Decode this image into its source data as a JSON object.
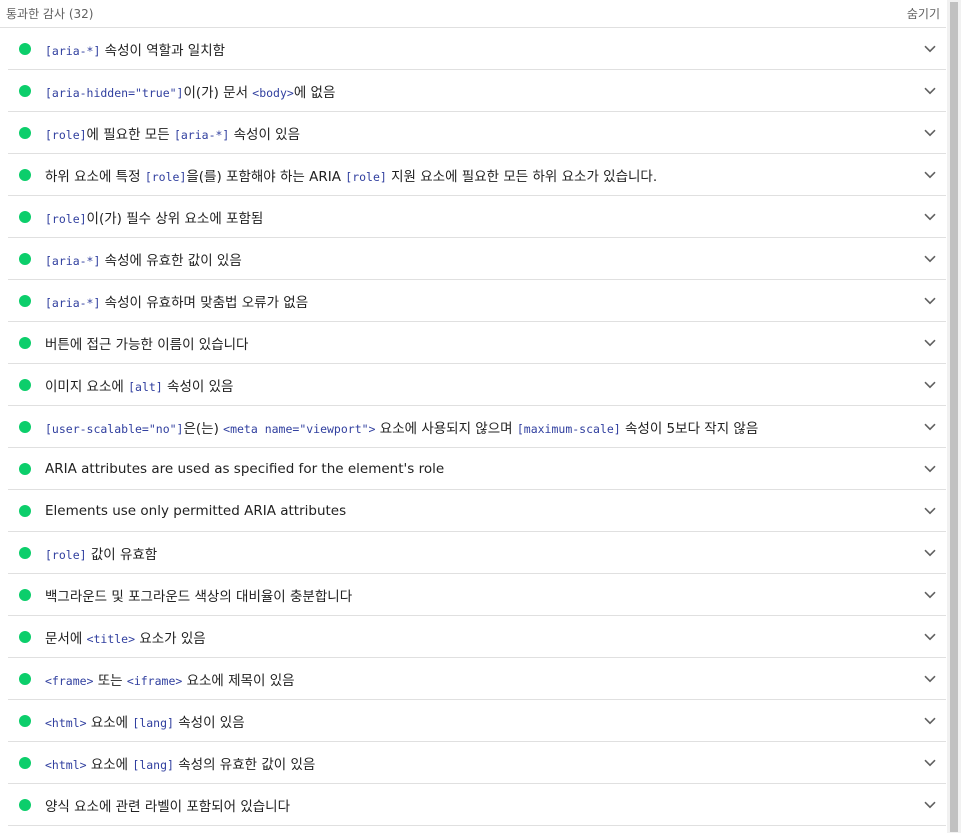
{
  "header": {
    "title": "통과한 감사 (32)",
    "toggle_label": "숨기기"
  },
  "colors": {
    "pass": "#0cce6b",
    "code": "#303f9f",
    "divider": "#e0e0e0"
  },
  "audits": [
    {
      "parts": [
        {
          "code": "[aria-*]"
        },
        {
          "text": " 속성이 역할과 일치함"
        }
      ]
    },
    {
      "parts": [
        {
          "code": "[aria-hidden=\"true\"]"
        },
        {
          "text": "이(가) 문서 "
        },
        {
          "code": "<body>"
        },
        {
          "text": "에 없음"
        }
      ]
    },
    {
      "parts": [
        {
          "code": "[role]"
        },
        {
          "text": "에 필요한 모든 "
        },
        {
          "code": "[aria-*]"
        },
        {
          "text": " 속성이 있음"
        }
      ]
    },
    {
      "parts": [
        {
          "text": "하위 요소에 특정 "
        },
        {
          "code": "[role]"
        },
        {
          "text": "을(를) 포함해야 하는 ARIA "
        },
        {
          "code": "[role]"
        },
        {
          "text": " 지원 요소에 필요한 모든 하위 요소가 있습니다."
        }
      ]
    },
    {
      "parts": [
        {
          "code": "[role]"
        },
        {
          "text": "이(가) 필수 상위 요소에 포함됨"
        }
      ]
    },
    {
      "parts": [
        {
          "code": "[aria-*]"
        },
        {
          "text": " 속성에 유효한 값이 있음"
        }
      ]
    },
    {
      "parts": [
        {
          "code": "[aria-*]"
        },
        {
          "text": " 속성이 유효하며 맞춤법 오류가 없음"
        }
      ]
    },
    {
      "parts": [
        {
          "text": "버튼에 접근 가능한 이름이 있습니다"
        }
      ]
    },
    {
      "parts": [
        {
          "text": "이미지 요소에 "
        },
        {
          "code": "[alt]"
        },
        {
          "text": " 속성이 있음"
        }
      ]
    },
    {
      "parts": [
        {
          "code": "[user-scalable=\"no\"]"
        },
        {
          "text": "은(는) "
        },
        {
          "code": "<meta name=\"viewport\">"
        },
        {
          "text": " 요소에 사용되지 않으며 "
        },
        {
          "code": "[maximum-scale]"
        },
        {
          "text": " 속성이 5보다 작지 않음"
        }
      ]
    },
    {
      "parts": [
        {
          "text": "ARIA attributes are used as specified for the element's role"
        }
      ]
    },
    {
      "parts": [
        {
          "text": "Elements use only permitted ARIA attributes"
        }
      ]
    },
    {
      "parts": [
        {
          "code": "[role]"
        },
        {
          "text": " 값이 유효함"
        }
      ]
    },
    {
      "parts": [
        {
          "text": "백그라운드 및 포그라운드 색상의 대비율이 충분합니다"
        }
      ]
    },
    {
      "parts": [
        {
          "text": "문서에 "
        },
        {
          "code": "<title>"
        },
        {
          "text": " 요소가 있음"
        }
      ]
    },
    {
      "parts": [
        {
          "code": "<frame>"
        },
        {
          "text": " 또는 "
        },
        {
          "code": "<iframe>"
        },
        {
          "text": " 요소에 제목이 있음"
        }
      ]
    },
    {
      "parts": [
        {
          "code": "<html>"
        },
        {
          "text": " 요소에 "
        },
        {
          "code": "[lang]"
        },
        {
          "text": " 속성이 있음"
        }
      ]
    },
    {
      "parts": [
        {
          "code": "<html>"
        },
        {
          "text": " 요소에 "
        },
        {
          "code": "[lang]"
        },
        {
          "text": " 속성의 유효한 값이 있음"
        }
      ]
    },
    {
      "parts": [
        {
          "text": "양식 요소에 관련 라벨이 포함되어 있습니다"
        }
      ]
    }
  ]
}
